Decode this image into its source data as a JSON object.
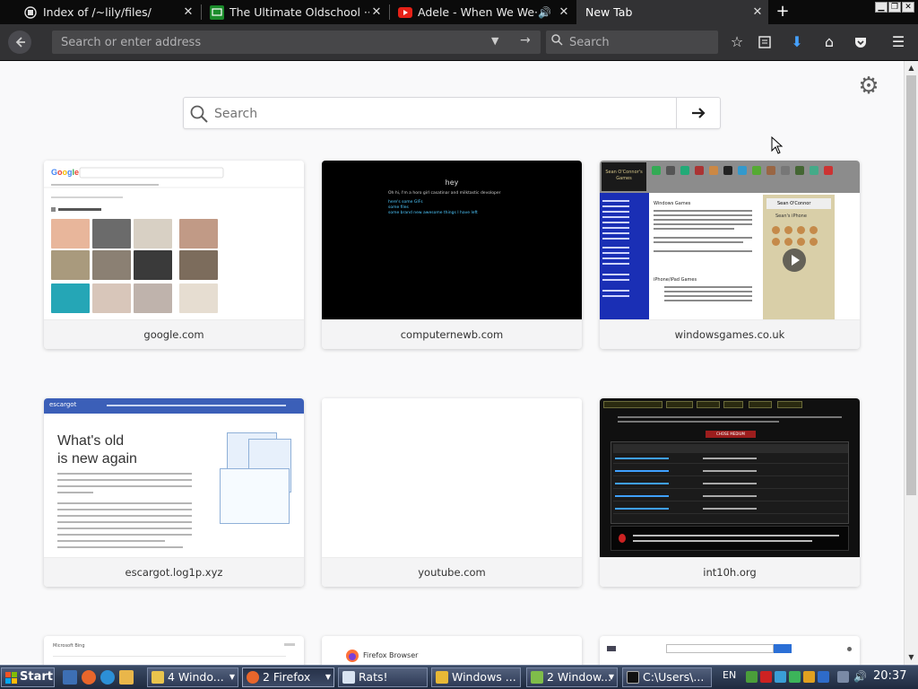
{
  "tabs": [
    {
      "title": "Index of /~lily/files/",
      "icon": "file-index-icon"
    },
    {
      "title": "The Ultimate Oldschool ···",
      "icon": "green-screen-icon"
    },
    {
      "title": "Adele - When We We···",
      "icon": "youtube-icon",
      "audio": true
    },
    {
      "title": "New Tab",
      "icon": "none",
      "active": true
    }
  ],
  "navbar": {
    "url_placeholder": "Search or enter address",
    "search_placeholder": "Search"
  },
  "newtab": {
    "search_placeholder": "Search",
    "tiles": [
      {
        "label": "google.com"
      },
      {
        "label": "computernewb.com"
      },
      {
        "label": "windowsgames.co.uk"
      },
      {
        "label": "escargot.log1p.xyz"
      },
      {
        "label": "youtube.com"
      },
      {
        "label": "int10h.org"
      }
    ],
    "previews": {
      "google": {
        "query": "rat",
        "images_for": "Images for rat sur"
      },
      "computernewb": {
        "heading": "hey",
        "line1": "Oh hi, I'm a horo girl casatinar and milktastic devoloper",
        "link1": "here's some GIFs",
        "link2": "some files",
        "link3": "some brand new awesome things I have left"
      },
      "windowsgames": {
        "logo": "Sean O'Connor's Games",
        "heading1": "Windows Games",
        "heading2": "iPhone/iPad Games",
        "profile": "Sean O'Connor",
        "right_heading": "Sean's iPhone"
      },
      "escargot": {
        "brand": "escargot",
        "title_line1": "What's old",
        "title_line2": "is new again"
      },
      "int10h": {
        "button": "CHOSE MEDIUM"
      }
    },
    "partial_tiles": [
      {
        "brand": "Microsoft Bing"
      },
      {
        "brand": "Firefox Browser"
      },
      {
        "brand": ""
      }
    ]
  },
  "taskbar": {
    "start_label": "Start",
    "buttons": [
      {
        "label": "4 Windo...",
        "icon": "folder-icon"
      },
      {
        "label": "2 Firefox",
        "icon": "firefox-icon",
        "active": true
      },
      {
        "label": "Rats!",
        "icon": "paint-icon"
      },
      {
        "label": "Windows ...",
        "icon": "windows-explorer-icon"
      },
      {
        "label": "2 Window...",
        "icon": "windows-media-icon"
      },
      {
        "label": "C:\\Users\\...",
        "icon": "cmd-icon"
      }
    ],
    "lang": "EN",
    "clock": "20:37"
  },
  "colors": {
    "tabstrip": "#0b0b0b",
    "navbar": "#323234",
    "content_bg": "#f9f9fa",
    "taskbar": "#2b3650"
  }
}
